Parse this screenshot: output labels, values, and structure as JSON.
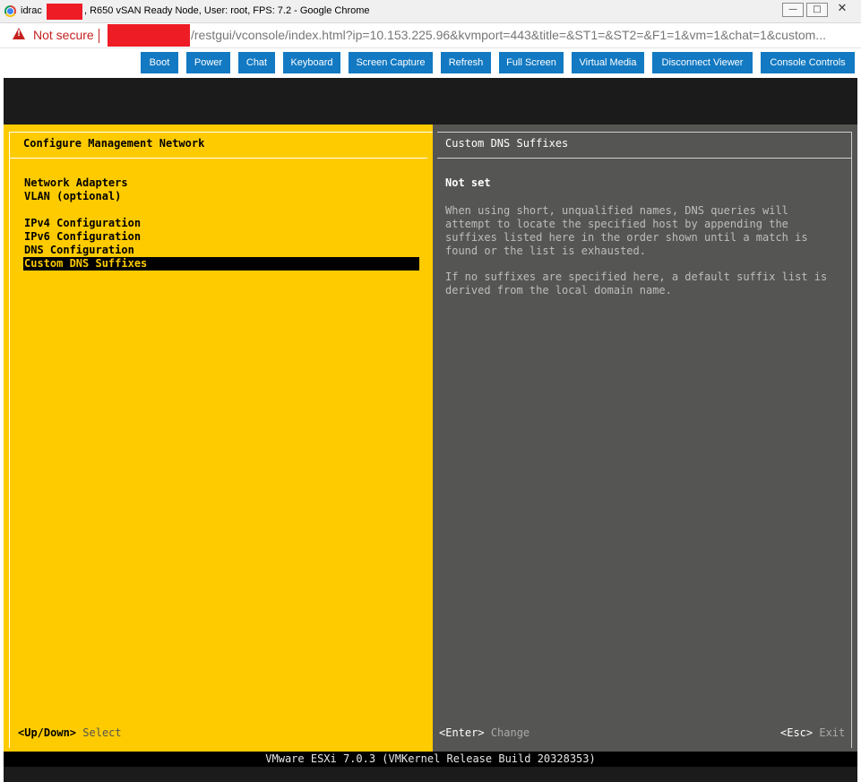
{
  "window": {
    "title_prefix": "idrac",
    "title_suffix": ", R650 vSAN Ready Node, User: root, FPS: 7.2 - Google Chrome",
    "controls": [
      "minimize",
      "restore",
      "close"
    ]
  },
  "address_bar": {
    "security_label": "Not secure",
    "url": "/restgui/vconsole/index.html?ip=10.153.225.96&kvmport=443&title=&ST1=&ST2=&F1=1&vm=1&chat=1&custom..."
  },
  "toolbar": {
    "buttons": [
      "Boot",
      "Power",
      "Chat",
      "Keyboard",
      "Screen Capture",
      "Refresh",
      "Full Screen",
      "Virtual Media",
      "Disconnect Viewer",
      "Console Controls"
    ]
  },
  "dcui": {
    "left_title": "Configure Management Network",
    "menu": [
      "Network Adapters",
      "VLAN (optional)",
      "IPv4 Configuration",
      "IPv6 Configuration",
      "DNS Configuration",
      "Custom DNS Suffixes"
    ],
    "selected_index": 5,
    "right_title": "Custom DNS Suffixes",
    "value": "Not set",
    "description_1": "When using short, unqualified names, DNS queries will\nattempt to locate the specified host by appending the\nsuffixes listed here in the order shown until a match is\nfound or the list is exhausted.",
    "description_2": "If no suffixes are specified here, a default suffix list is\nderived from the local domain name.",
    "status_left_key": "<Up/Down>",
    "status_left_action": "Select",
    "status_mid_key": "<Enter>",
    "status_mid_action": "Change",
    "status_right_key": "<Esc>",
    "status_right_action": "Exit",
    "footer": "VMware ESXi 7.0.3 (VMKernel Release Build 20328353)"
  },
  "colors": {
    "left_panel": "#fecb00",
    "right_panel": "#555553",
    "toolbar_button": "#1279c2",
    "warning": "#c5221f"
  }
}
